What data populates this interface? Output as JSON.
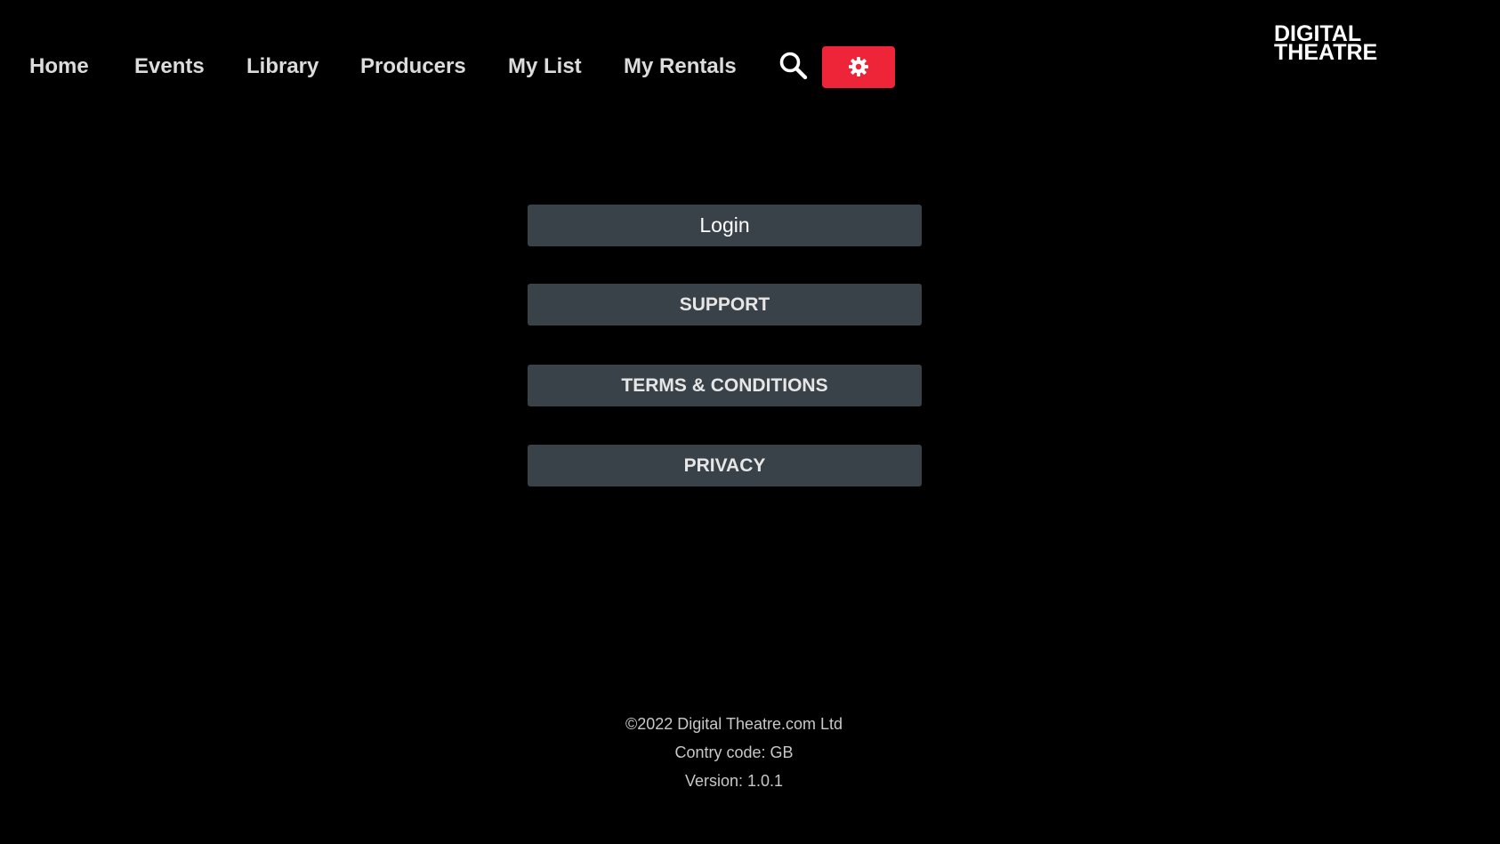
{
  "nav": {
    "items": [
      {
        "label": "Home"
      },
      {
        "label": "Events"
      },
      {
        "label": "Library"
      },
      {
        "label": "Producers"
      },
      {
        "label": "My List"
      },
      {
        "label": "My Rentals"
      }
    ],
    "search_icon": "search-icon",
    "settings_icon": "gear-icon"
  },
  "logo": {
    "line1": "DIGITAL",
    "line2": "THEATRE"
  },
  "menu": {
    "login": "Login",
    "support": "SUPPORT",
    "terms": "TERMS & CONDITIONS",
    "privacy": "PRIVACY"
  },
  "footer": {
    "copyright": "©2022 Digital Theatre.com Ltd",
    "country": "Contry code: GB",
    "version": "Version: 1.0.1"
  },
  "colors": {
    "background": "#000000",
    "accent": "#ee2439",
    "button_bg": "#3a4249"
  }
}
